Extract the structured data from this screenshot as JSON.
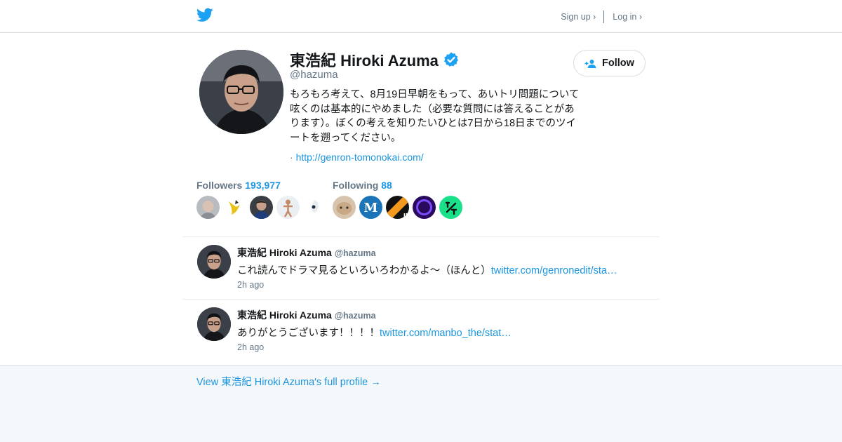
{
  "header": {
    "logo_icon": "twitter-bird-icon",
    "signup_label": "Sign up ›",
    "login_label": "Log in ›"
  },
  "profile": {
    "name": "東浩紀 Hiroki Azuma",
    "verified_icon": "verified-badge-icon",
    "handle": "@hazuma",
    "bio": "もろもろ考えて、8月19日早朝をもって、あいトリ問題について呟くのは基本的にやめました（必要な質問には答えることがあります）。ぼくの考えを知りたいひとは7日から18日までのツイートを遡ってください。",
    "url_prefix": "·",
    "url": "http://genron-tomonokai.com/",
    "follow_label": "Follow",
    "followers_label": "Followers",
    "followers_count": "193,977",
    "following_label": "Following",
    "following_count": "88"
  },
  "tweets": [
    {
      "name": "東浩紀 Hiroki Azuma",
      "handle": "@hazuma",
      "text": "これ読んでドラマ見るといろいろわかるよ〜（ほんと）",
      "link": "twitter.com/genronedit/sta…",
      "time": "2h ago"
    },
    {
      "name": "東浩紀 Hiroki Azuma",
      "handle": "@hazuma",
      "text": "ありがとうございます！！！！",
      "link": "twitter.com/manbo_the/stat…",
      "time": "2h ago"
    }
  ],
  "footer": {
    "full_profile_label": "View 東浩紀 Hiroki Azuma's full profile →"
  },
  "colors": {
    "brand": "#1da1f2",
    "link": "#1b95e0",
    "muted": "#657786"
  }
}
